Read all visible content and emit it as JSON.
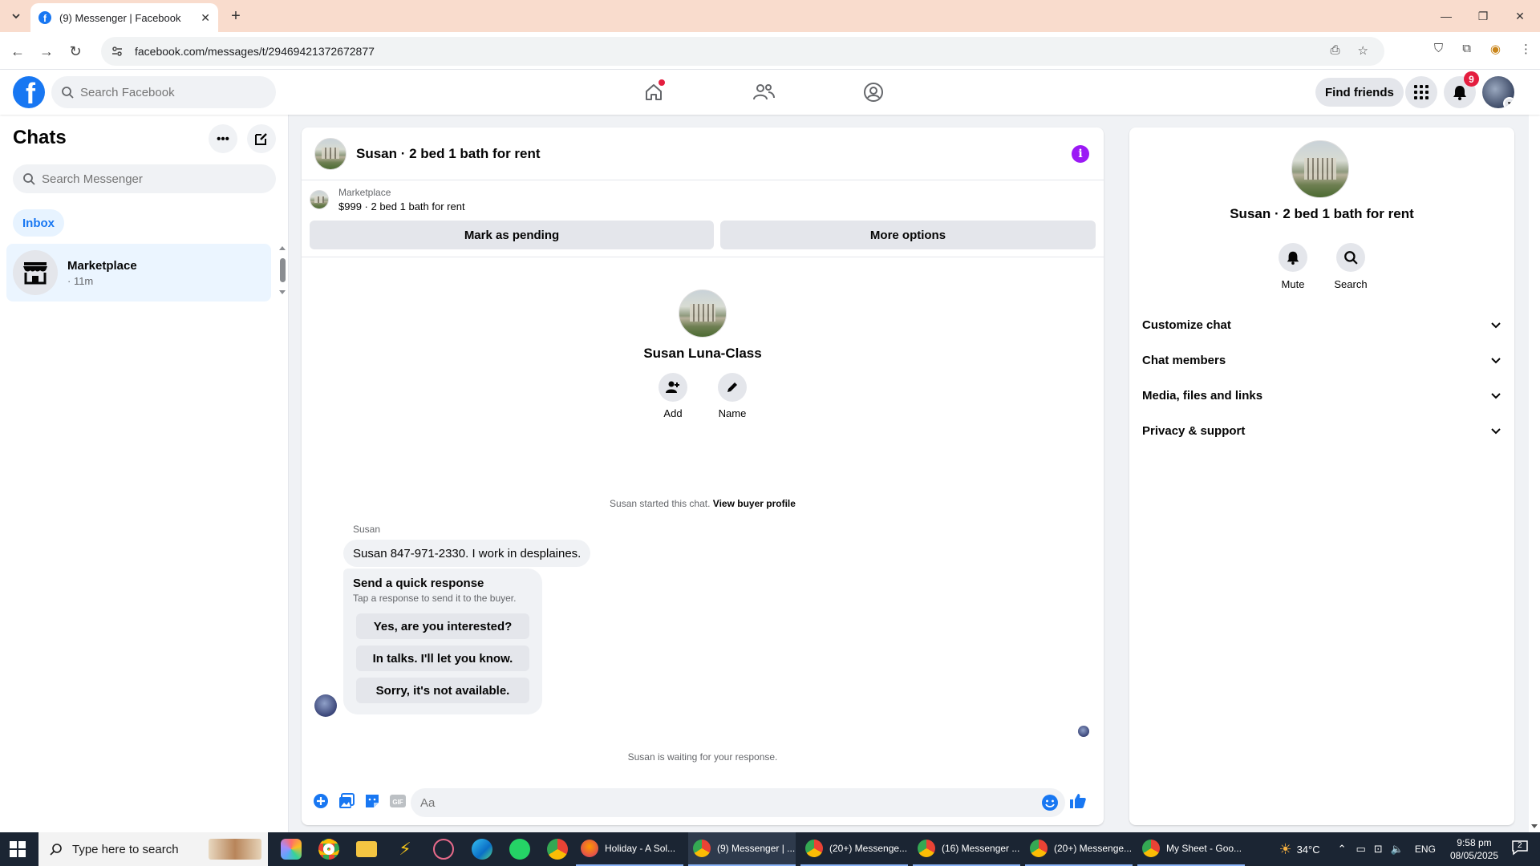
{
  "browser": {
    "tab_title": "(9) Messenger | Facebook",
    "url": "facebook.com/messages/t/29469421372672877"
  },
  "fb_nav": {
    "search_placeholder": "Search Facebook",
    "find_friends": "Find friends",
    "notification_count": "9"
  },
  "chats": {
    "title": "Chats",
    "search_placeholder": "Search Messenger",
    "inbox_label": "Inbox",
    "items": [
      {
        "name": "Marketplace",
        "time": "· 11m"
      }
    ]
  },
  "conversation": {
    "title": "Susan · 2 bed 1 bath for rent",
    "marketplace_label": "Marketplace",
    "listing": "$999 · 2 bed 1 bath for rent",
    "mark_pending": "Mark as pending",
    "more_options": "More options",
    "contact_name": "Susan Luna-Class",
    "add_label": "Add",
    "name_label": "Name",
    "started_text": "Susan started this chat.",
    "view_buyer_profile": "View buyer profile",
    "sender": "Susan",
    "message": "Susan 847-971-2330.  I work in desplaines.",
    "quick_response_title": "Send a quick response",
    "quick_response_sub": "Tap a response to send it to the buyer.",
    "quick_responses": [
      "Yes, are you interested?",
      "In talks. I'll let you know.",
      "Sorry, it's not available."
    ],
    "waiting_text": "Susan is waiting for your response.",
    "composer_placeholder": "Aa"
  },
  "info_panel": {
    "title": "Susan · 2 bed 1 bath for rent",
    "mute": "Mute",
    "search": "Search",
    "sections": [
      "Customize chat",
      "Chat members",
      "Media, files and links",
      "Privacy & support"
    ]
  },
  "taskbar": {
    "search_placeholder": "Type here to search",
    "apps": [
      "Holiday - A Sol...",
      "(9) Messenger | ...",
      "(20+) Messenge...",
      "(16) Messenger ...",
      "(20+) Messenge...",
      "My Sheet - Goo..."
    ],
    "temperature": "34°C",
    "language": "ENG",
    "time": "9:58 pm",
    "date": "08/05/2025",
    "notifications": "2"
  },
  "colors": {
    "fb_blue": "#1877f2",
    "info_purple": "#9b19f5",
    "badge_red": "#e41e3f",
    "tabbar": "#f9dccd"
  }
}
